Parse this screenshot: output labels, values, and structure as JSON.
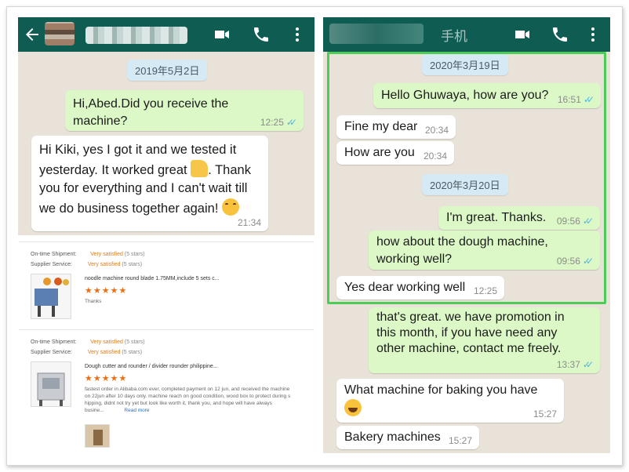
{
  "left_chat": {
    "date": "2019年5月2日",
    "messages": [
      {
        "text_l1": "Hi,Abed.Did you receive the",
        "text_l2": "machine?",
        "time": "12:25"
      },
      {
        "text_l1": "Hi Kiki, yes I got it and we tested it",
        "text_l2": "yesterday. It worked great",
        "text_l2b": ". Thank",
        "text_l3": "you for everything and I can't wait till",
        "text_l4": "we do business together again!",
        "time": "21:34"
      }
    ]
  },
  "reviews": [
    {
      "shipment_label": "On-time Shipment:",
      "shipment_value": "Very satisfied",
      "shipment_stars": "(5 stars)",
      "service_label": "Supplier Service:",
      "service_value": "Very satisfied",
      "service_stars": "(5 stars)",
      "product": "noodle machine round blade 1.75MM,include 5 sets c...",
      "stars": "★★★★★",
      "comment": "Thanks"
    },
    {
      "shipment_label": "On-time Shipment:",
      "shipment_value": "Very satisfied",
      "shipment_stars": "(5 stars)",
      "service_label": "Supplier Service:",
      "service_value": "Very satisfied",
      "service_stars": "(5 stars)",
      "product": "Dough cutter and rounder / divider rounder philippine...",
      "stars": "★★★★★",
      "comment_l1": "fastest order in Alibaba.com ever, completed payment on 12 jun, and received the machine",
      "comment_l2": "on 22jun after 10 days only. machine reach on good condition, wood box to protect during s",
      "comment_l3": "hipping, didnt not try yet but look like worth it, thank you, and hope will have always",
      "comment_l4": "busine...",
      "read_more": "Read more"
    }
  ],
  "right_chat": {
    "header_text": "手机",
    "dates": [
      "2020年3月19日",
      "2020年3月20日"
    ],
    "messages": [
      {
        "text": "Hello Ghuwaya, how are you?",
        "time": "16:51"
      },
      {
        "text": "Fine my dear",
        "time": "20:34"
      },
      {
        "text": "How are you",
        "time": "20:34"
      },
      {
        "text": "I'm great. Thanks.",
        "time": "09:56"
      },
      {
        "text_l1": "how about the dough machine,",
        "text_l2": "working well?",
        "time": "09:56"
      },
      {
        "text": "Yes dear working well",
        "time": "12:25"
      },
      {
        "text_l1": "that's great. we have promotion in",
        "text_l2": "this month, if you have need any",
        "text_l3": "other machine, contact me freely.",
        "time": "13:37"
      },
      {
        "text": "What machine for baking you have",
        "time": "15:27"
      },
      {
        "text": "Bakery machines",
        "time": "15:27"
      }
    ]
  },
  "colors": {
    "header": "#0e5c52",
    "outgoing": "#dcf8c6",
    "incoming": "#ffffff",
    "highlight": "#4ccd58",
    "ticks": "#4fb6ec"
  }
}
